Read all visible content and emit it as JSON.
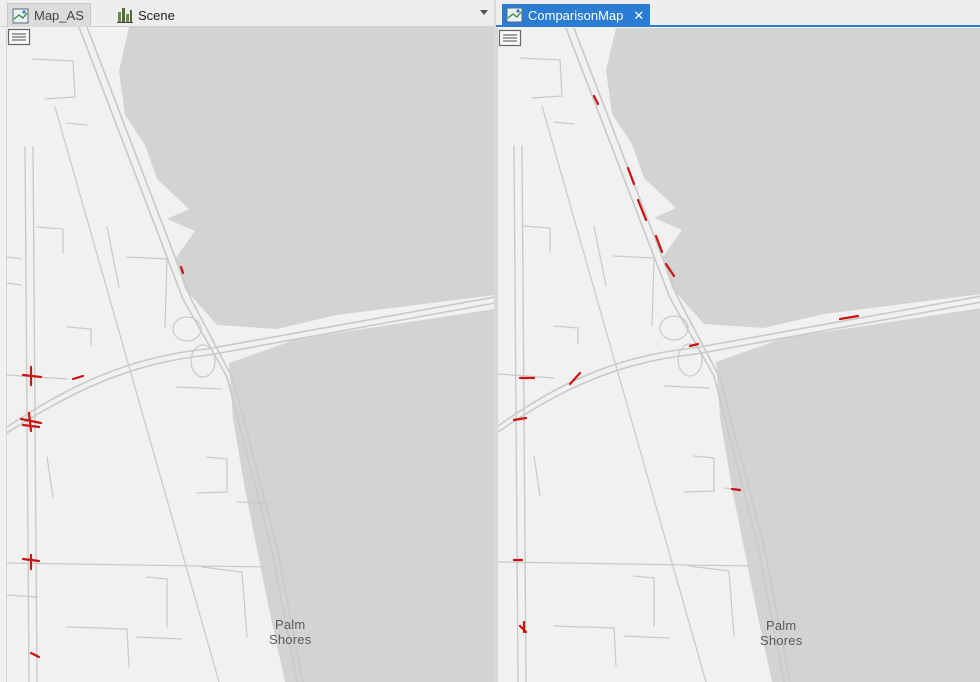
{
  "left_pane": {
    "tabs": [
      {
        "label": "Map_AS",
        "icon": "map-icon",
        "active": false
      },
      {
        "label": "Scene",
        "icon": "scene-icon",
        "active": false
      }
    ],
    "place_label": [
      "Palm",
      "Shores"
    ]
  },
  "right_pane": {
    "tabs": [
      {
        "label": "ComparisonMap",
        "icon": "map-icon",
        "active": true,
        "close": "✕"
      }
    ],
    "place_label": [
      "Palm",
      "Shores"
    ]
  },
  "colors": {
    "water": "#d2d4d4",
    "land": "#f1f1f1",
    "road": "#c9c9c9",
    "highlight": "#cc1111",
    "active_tab": "#2b7cd3"
  }
}
